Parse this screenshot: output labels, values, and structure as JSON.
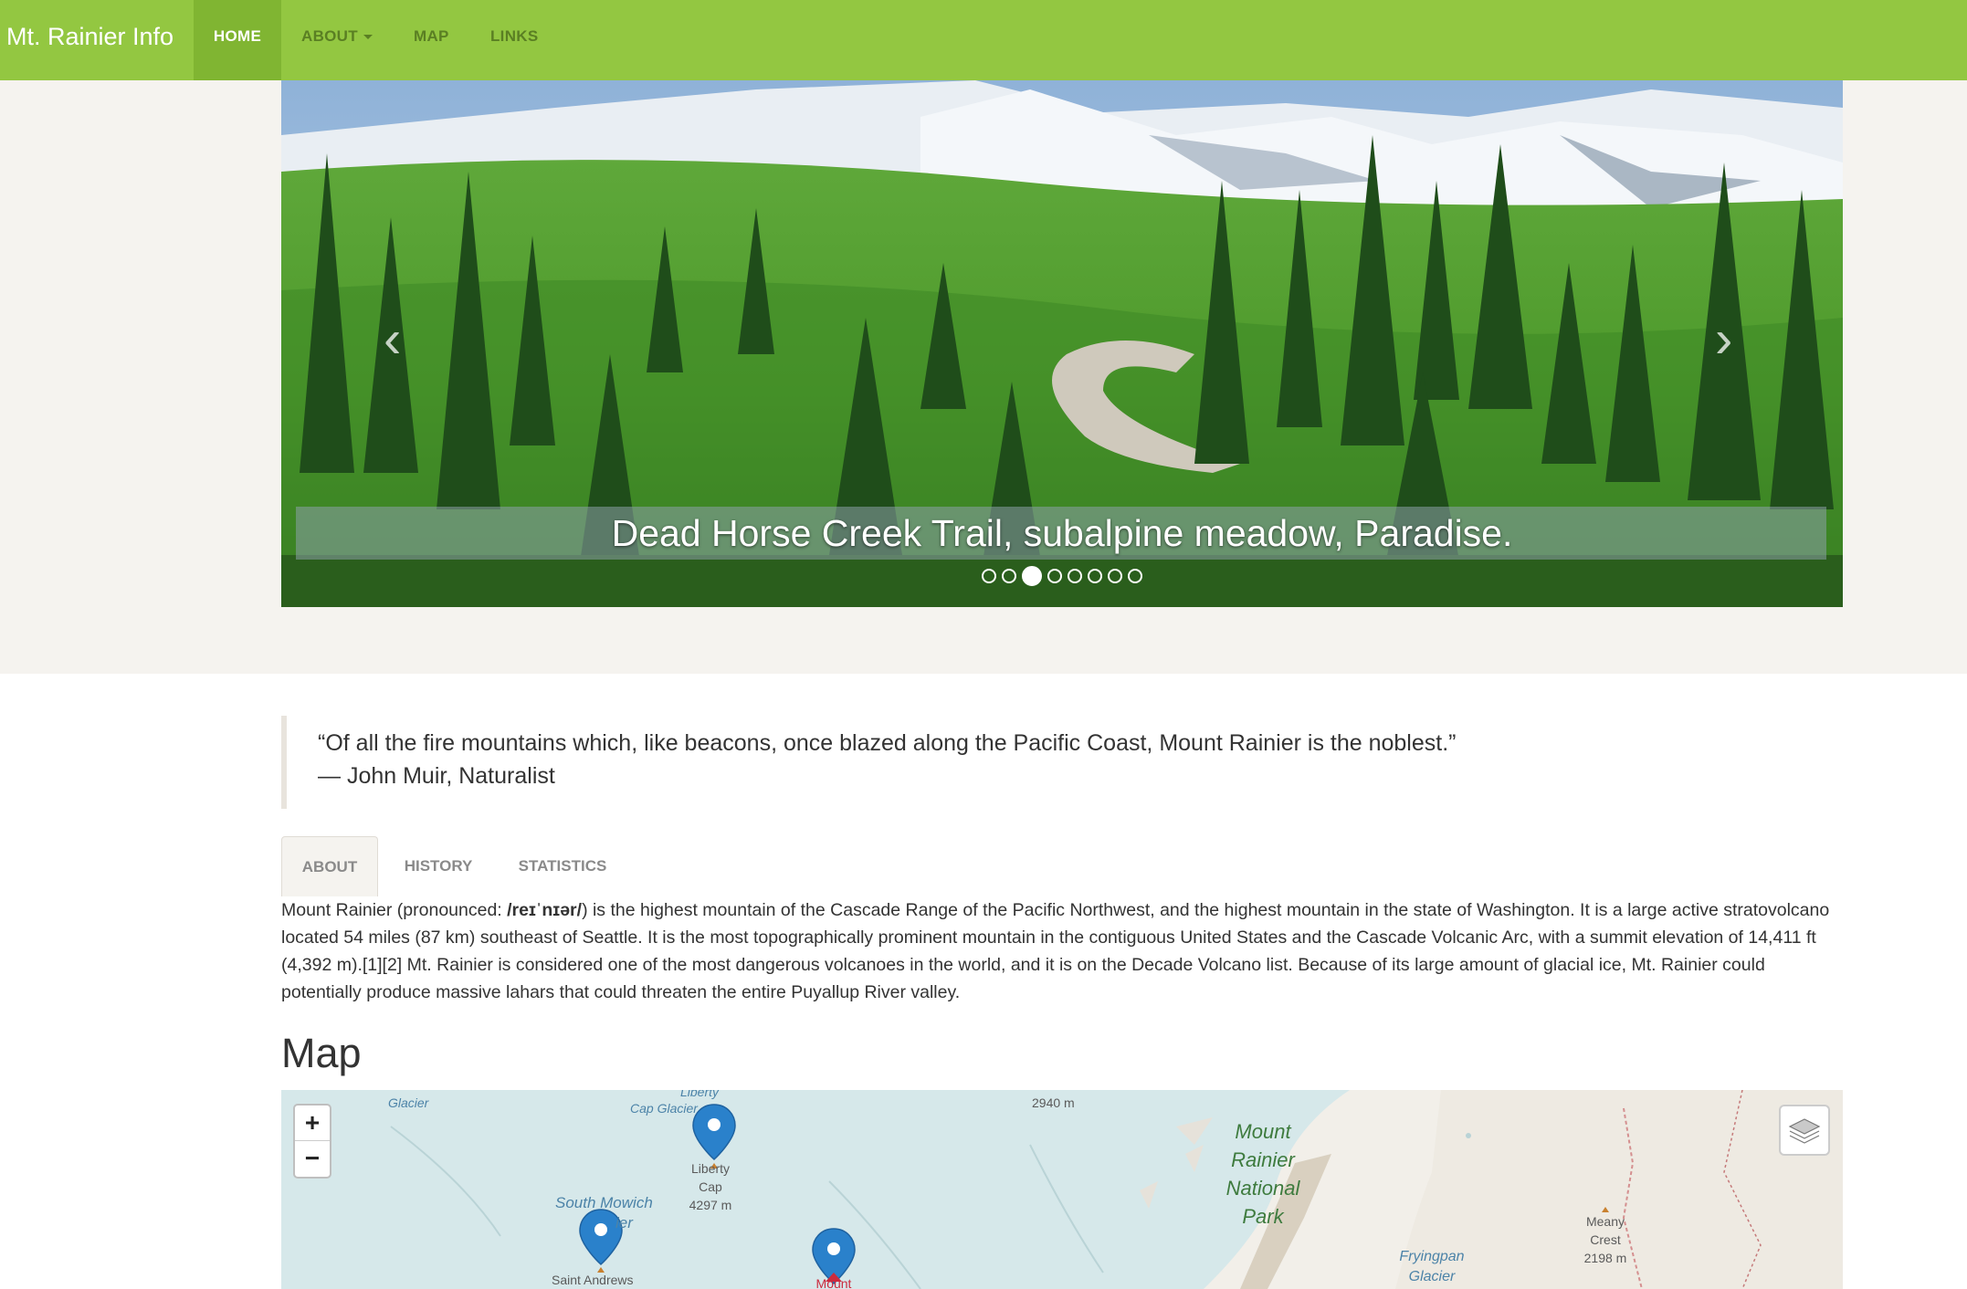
{
  "navbar": {
    "brand": "Mt. Rainier Info",
    "items": [
      {
        "label": "HOME"
      },
      {
        "label": "ABOUT"
      },
      {
        "label": "MAP"
      },
      {
        "label": "LINKS"
      }
    ]
  },
  "carousel": {
    "caption": "Dead Horse Creek Trail, subalpine meadow, Paradise.",
    "prev_icon": "‹",
    "next_icon": "›",
    "indicator_count": 8,
    "active_index": 2
  },
  "quote": {
    "text": "“Of all the fire mountains which, like beacons, once blazed along the Pacific Coast, Mount Rainier is the noblest.”",
    "attribution": "— John Muir, Naturalist"
  },
  "tabs": [
    {
      "label": "ABOUT"
    },
    {
      "label": "HISTORY"
    },
    {
      "label": "STATISTICS"
    }
  ],
  "about": {
    "before_ipa": "Mount Rainier (pronounced: ",
    "ipa": "/reɪˈnɪər/",
    "after_ipa": ") is the highest mountain of the Cascade Range of the Pacific Northwest, and the highest mountain in the state of Washington. It is a large active stratovolcano located 54 miles (87 km) southeast of Seattle. It is the most topographically prominent mountain in the contiguous United States and the Cascade Volcanic Arc, with a summit elevation of 14,411 ft (4,392 m).[1][2] Mt. Rainier is considered one of the most dangerous volcanoes in the world, and it is on the Decade Volcano list. Because of its large amount of glacial ice, Mt. Rainier could potentially produce massive lahars that could threaten the entire Puyallup River valley."
  },
  "map": {
    "heading": "Map",
    "zoom_in": "+",
    "zoom_out": "−",
    "labels": {
      "glacier": "Glacier",
      "liberty_cap_glacier_1": "Liberty",
      "liberty_cap_glacier_2": "Cap Glacier",
      "elev_2940": "2940 m",
      "liberty_cap_1": "Liberty",
      "liberty_cap_2": "Cap",
      "liberty_cap_3": "4297 m",
      "south_mowich_1": "South Mowich",
      "south_mowich_2": "ier",
      "saint_andrews": "Saint Andrews",
      "mount": "Mount",
      "park_1": "Mount",
      "park_2": "Rainier",
      "park_3": "National",
      "park_4": "Park",
      "meany_1": "Meany",
      "meany_2": "Crest",
      "meany_3": "2198 m",
      "fryingpan_1": "Fryingpan",
      "fryingpan_2": "Glacier"
    },
    "colors": {
      "marker_blue": "#2a81cb",
      "marker_red": "#cb2b3e",
      "water": "#d6e8ea",
      "land": "#f2efe9"
    }
  },
  "colors": {
    "navbar": "#93c741",
    "navbar_active": "#80b532",
    "hero_bg": "#f5f3ef"
  }
}
